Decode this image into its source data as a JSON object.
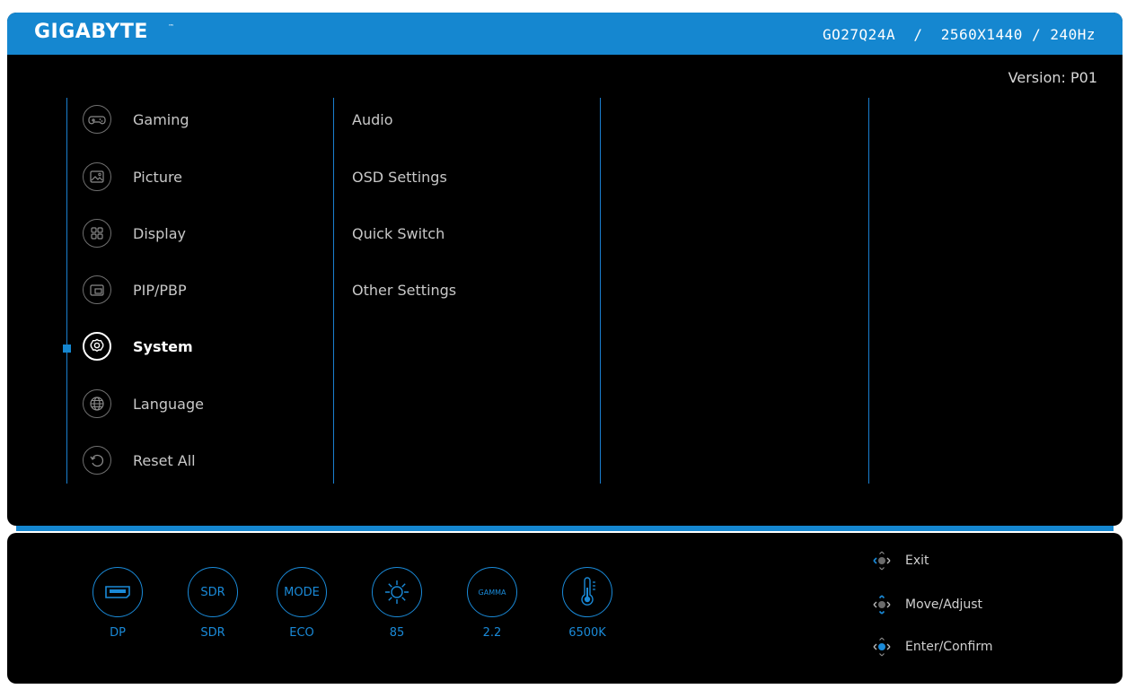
{
  "header": {
    "brand": "GIGABYTE",
    "brand_tm": "™",
    "model_info": "GO27Q24A  /  2560X1440 / 240Hz",
    "version": "Version: P01"
  },
  "menu": {
    "items": [
      {
        "label": "Gaming",
        "icon": "gamepad-icon"
      },
      {
        "label": "Picture",
        "icon": "picture-icon"
      },
      {
        "label": "Display",
        "icon": "display-grid-icon"
      },
      {
        "label": "PIP/PBP",
        "icon": "pip-icon"
      },
      {
        "label": "System",
        "icon": "system-gear-icon",
        "active": true
      },
      {
        "label": "Language",
        "icon": "globe-icon"
      },
      {
        "label": "Reset All",
        "icon": "reset-icon"
      }
    ]
  },
  "submenu": {
    "items": [
      {
        "label": "Audio"
      },
      {
        "label": "OSD Settings"
      },
      {
        "label": "Quick Switch"
      },
      {
        "label": "Other Settings"
      }
    ]
  },
  "status": {
    "items": [
      {
        "icon": "displayport-icon",
        "value": "DP"
      },
      {
        "circle_text": "SDR",
        "value": "SDR"
      },
      {
        "circle_text": "MODE",
        "value": "ECO"
      },
      {
        "icon": "brightness-icon",
        "value": "85"
      },
      {
        "circle_text": "GAMMA",
        "value": "2.2"
      },
      {
        "icon": "thermometer-icon",
        "value": "6500K"
      }
    ]
  },
  "hints": {
    "items": [
      {
        "label": "Exit",
        "icon": "joystick-left-icon"
      },
      {
        "label": "Move/Adjust",
        "icon": "joystick-updown-icon"
      },
      {
        "label": "Enter/Confirm",
        "icon": "joystick-press-icon"
      }
    ]
  },
  "colors": {
    "accent": "#1587d0",
    "background": "#000000",
    "text": "#c8c8c8"
  }
}
